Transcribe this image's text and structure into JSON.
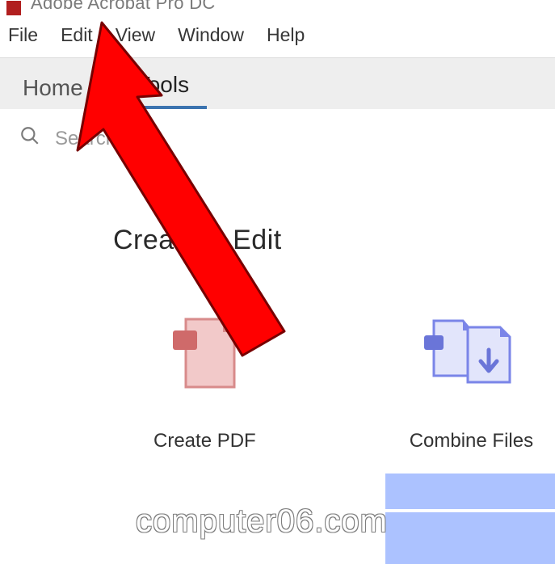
{
  "title_bar": {
    "app_title": "Adobe Acrobat Pro DC"
  },
  "menu": {
    "file": "File",
    "edit": "Edit",
    "view": "View",
    "window": "Window",
    "help": "Help"
  },
  "tabs": {
    "home": "Home",
    "tools": "Tools"
  },
  "search": {
    "placeholder": "Search tools"
  },
  "section": {
    "title": "Create & Edit"
  },
  "tools": {
    "create_pdf": "Create PDF",
    "combine_files": "Combine Files"
  },
  "watermark": "computer06.com",
  "colors": {
    "arrow": "#ff0000",
    "highlight": "#4a78ff",
    "create_icon": "#d88b8b",
    "combine_icon": "#7a85e8"
  }
}
